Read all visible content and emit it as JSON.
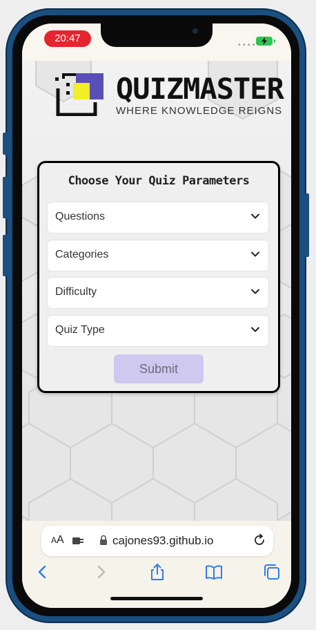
{
  "status_bar": {
    "time": "20:47",
    "signal": "••••"
  },
  "logo": {
    "brand": "QUIZMASTER",
    "tagline": "WHERE KNOWLEDGE REIGNS"
  },
  "quiz_form": {
    "title": "Choose Your Quiz Parameters",
    "selects": [
      {
        "label": "Questions"
      },
      {
        "label": "Categories"
      },
      {
        "label": "Difficulty"
      },
      {
        "label": "Quiz Type"
      }
    ],
    "submit_label": "Submit"
  },
  "browser": {
    "text_size_label_large": "A",
    "text_size_label_small": "A",
    "url": "cajones93.github.io"
  },
  "colors": {
    "frame": "#1a4f80",
    "time_pill": "#e4252f",
    "battery": "#30c452",
    "submit_bg": "#cfc8ef",
    "ios_blue": "#2f7bf5",
    "logo_purple": "#5a4fb8",
    "logo_yellow": "#f1ee2a"
  },
  "icons": [
    "battery-icon",
    "logo-icon",
    "chevron-down-icon",
    "extension-icon",
    "lock-icon",
    "reload-icon",
    "back-icon",
    "forward-icon",
    "share-icon",
    "bookmarks-icon",
    "tabs-icon"
  ]
}
